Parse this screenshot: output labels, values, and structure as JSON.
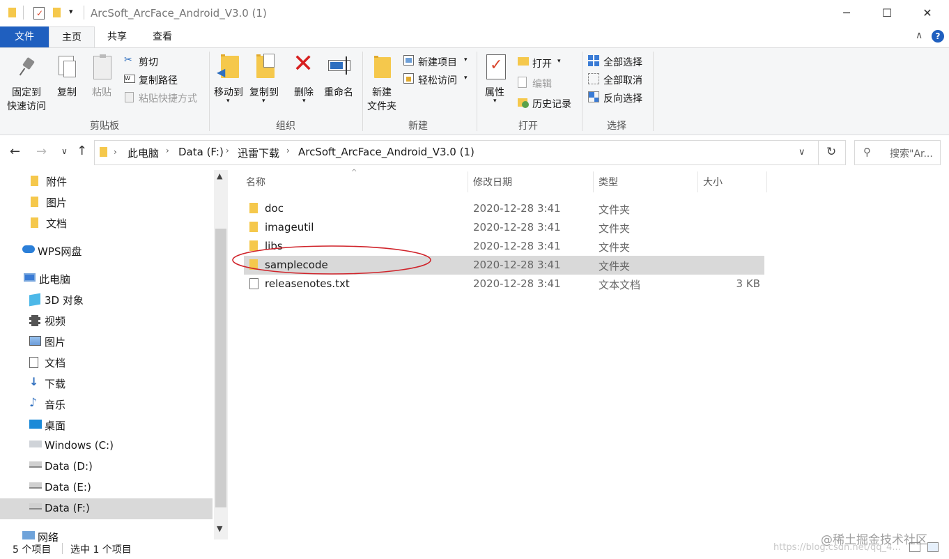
{
  "window": {
    "title": "ArcSoft_ArcFace_Android_V3.0 (1)",
    "minimize": "─",
    "maximize": "☐",
    "close": "✕"
  },
  "ribbon_tabs": [
    "文件",
    "主页",
    "共享",
    "查看"
  ],
  "ribbon": {
    "clipboard": {
      "pin_line1": "固定到",
      "pin_line2": "快速访问",
      "copy": "复制",
      "paste": "粘贴",
      "cut": "剪切",
      "copy_path": "复制路径",
      "paste_shortcut": "粘贴快捷方式",
      "label": "剪贴板"
    },
    "organize": {
      "move_to": "移动到",
      "copy_to": "复制到",
      "delete": "删除",
      "rename": "重命名",
      "label": "组织"
    },
    "new": {
      "new_folder_line1": "新建",
      "new_folder_line2": "文件夹",
      "new_item": "新建项目",
      "easy_access": "轻松访问",
      "label": "新建"
    },
    "open": {
      "properties": "属性",
      "open": "打开",
      "edit": "编辑",
      "history": "历史记录",
      "label": "打开"
    },
    "select": {
      "select_all": "全部选择",
      "select_none": "全部取消",
      "invert": "反向选择",
      "label": "选择"
    }
  },
  "breadcrumb": [
    "此电脑",
    "Data (F:)",
    "迅雷下载",
    "ArcSoft_ArcFace_Android_V3.0 (1)"
  ],
  "search": {
    "placeholder": "搜索\"Ar..."
  },
  "nav_pane": [
    {
      "label": "附件",
      "icon": "folder-icon"
    },
    {
      "label": "图片",
      "icon": "folder-icon"
    },
    {
      "label": "文档",
      "icon": "folder-icon"
    },
    {
      "label": "WPS网盘",
      "icon": "cloud-icon"
    },
    {
      "label": "此电脑",
      "icon": "computer-icon"
    },
    {
      "label": "3D 对象",
      "icon": "cube-icon"
    },
    {
      "label": "视频",
      "icon": "film-icon"
    },
    {
      "label": "图片",
      "icon": "picture-icon"
    },
    {
      "label": "文档",
      "icon": "document-icon"
    },
    {
      "label": "下载",
      "icon": "download-icon"
    },
    {
      "label": "音乐",
      "icon": "music-icon"
    },
    {
      "label": "桌面",
      "icon": "desktop-icon"
    },
    {
      "label": "Windows (C:)",
      "icon": "windows-drive-icon"
    },
    {
      "label": "Data (D:)",
      "icon": "drive-icon"
    },
    {
      "label": "Data (E:)",
      "icon": "drive-icon"
    },
    {
      "label": "Data (F:)",
      "icon": "drive-icon"
    },
    {
      "label": "网络",
      "icon": "network-icon"
    }
  ],
  "columns": {
    "name": "名称",
    "date": "修改日期",
    "type": "类型",
    "size": "大小"
  },
  "files": [
    {
      "name": "doc",
      "date": "2020-12-28 3:41",
      "type": "文件夹",
      "size": ""
    },
    {
      "name": "imageutil",
      "date": "2020-12-28 3:41",
      "type": "文件夹",
      "size": ""
    },
    {
      "name": "libs",
      "date": "2020-12-28 3:41",
      "type": "文件夹",
      "size": ""
    },
    {
      "name": "samplecode",
      "date": "2020-12-28 3:41",
      "type": "文件夹",
      "size": ""
    },
    {
      "name": "releasenotes.txt",
      "date": "2020-12-28 3:41",
      "type": "文本文档",
      "size": "3 KB"
    }
  ],
  "status": {
    "count": "5 个项目",
    "selected": "选中 1 个项目"
  },
  "watermark": {
    "line1": "@稀土掘金技术社区",
    "line2": "https://blog.csdn.net/qq_4..."
  },
  "colors": {
    "accent": "#1f5fbf",
    "selected_row": "#d9d9d9",
    "annotation_ellipse": "#d0242b"
  }
}
